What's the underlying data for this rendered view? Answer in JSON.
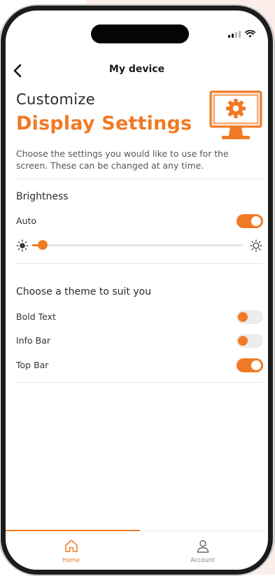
{
  "theme": {
    "accent": "#f07a24",
    "text": "#2b2b2b",
    "muted": "#555555",
    "toggle_off": "#ececec"
  },
  "status_bar": {
    "icons": [
      "cellular-signal-icon",
      "wifi-icon"
    ]
  },
  "header": {
    "title": "My device",
    "back_icon": "chevron-left-icon"
  },
  "hero": {
    "kicker": "Customize",
    "title": "Display Settings",
    "description": "Choose the settings you would like to use for the screen. These can be changed at any time.",
    "illustration": "monitor-gear-icon"
  },
  "brightness": {
    "heading": "Brightness",
    "auto_label": "Auto",
    "auto_on": true,
    "level_percent": 5,
    "low_icon": "sun-dim-icon",
    "high_icon": "sun-bright-icon"
  },
  "theme_section": {
    "heading": "Choose a theme to suit you",
    "options": [
      {
        "label": "Bold Text",
        "on": false
      },
      {
        "label": "Info Bar",
        "on": false
      },
      {
        "label": "Top Bar",
        "on": true
      }
    ]
  },
  "tabbar": {
    "tabs": [
      {
        "label": "Home",
        "icon": "home-icon",
        "active": true
      },
      {
        "label": "Account",
        "icon": "user-icon",
        "active": false
      }
    ]
  }
}
